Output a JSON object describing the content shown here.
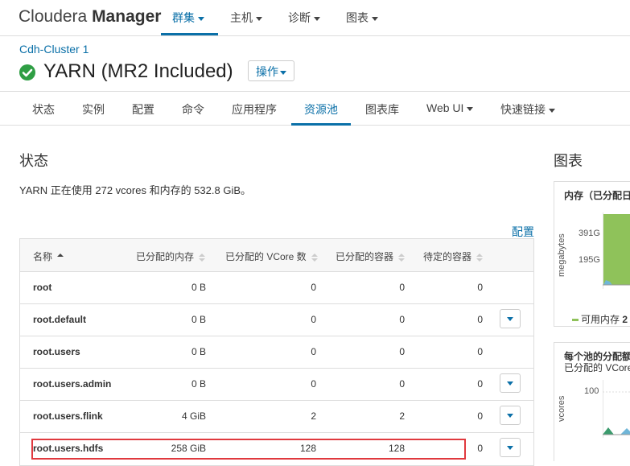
{
  "app": {
    "brand_light": "Cloudera ",
    "brand_bold": "Manager"
  },
  "topnav": [
    {
      "label": "群集",
      "active": true
    },
    {
      "label": "主机",
      "active": false
    },
    {
      "label": "诊断",
      "active": false
    },
    {
      "label": "图表",
      "active": false
    }
  ],
  "breadcrumb": {
    "cluster": "Cdh-Cluster 1"
  },
  "service": {
    "title": "YARN (MR2 Included)",
    "action_label": "操作"
  },
  "tabs": [
    {
      "label": "状态"
    },
    {
      "label": "实例"
    },
    {
      "label": "配置"
    },
    {
      "label": "命令"
    },
    {
      "label": "应用程序"
    },
    {
      "label": "资源池"
    },
    {
      "label": "图表库"
    },
    {
      "label": "Web UI"
    },
    {
      "label": "快速链接"
    }
  ],
  "status": {
    "title": "状态",
    "summary": "YARN 正在使用 272 vcores 和内存的 532.8 GiB。",
    "config_link": "配置"
  },
  "table": {
    "headers": [
      "名称",
      "已分配的内存",
      "已分配的 VCore 数",
      "已分配的容器",
      "待定的容器"
    ],
    "rows": [
      {
        "name": "root",
        "mem": "0 B",
        "vcore": "0",
        "containers": "0",
        "pending": "0"
      },
      {
        "name": "root.default",
        "mem": "0 B",
        "vcore": "0",
        "containers": "0",
        "pending": "0"
      },
      {
        "name": "root.users",
        "mem": "0 B",
        "vcore": "0",
        "containers": "0",
        "pending": "0"
      },
      {
        "name": "root.users.admin",
        "mem": "0 B",
        "vcore": "0",
        "containers": "0",
        "pending": "0"
      },
      {
        "name": "root.users.flink",
        "mem": "4 GiB",
        "vcore": "2",
        "containers": "2",
        "pending": "0"
      },
      {
        "name": "root.users.hdfs",
        "mem": "258 GiB",
        "vcore": "128",
        "containers": "128",
        "pending": "0"
      }
    ]
  },
  "charts": {
    "title": "图表",
    "mem_chart": {
      "title": "内存（已分配日",
      "ylabel": "megabytes",
      "ticks": [
        "391G",
        "195G"
      ],
      "legend": "可用内存",
      "legend_value": "2"
    },
    "vcore_chart": {
      "title": "每个池的分配额",
      "subtitle": "已分配的 VCore",
      "ylabel": "vcores",
      "ticks": [
        "100"
      ]
    }
  },
  "colors": {
    "accent": "#0b70a8",
    "success": "#2f9e44",
    "chart_green": "#8fc25a",
    "highlight": "#e0393e"
  }
}
